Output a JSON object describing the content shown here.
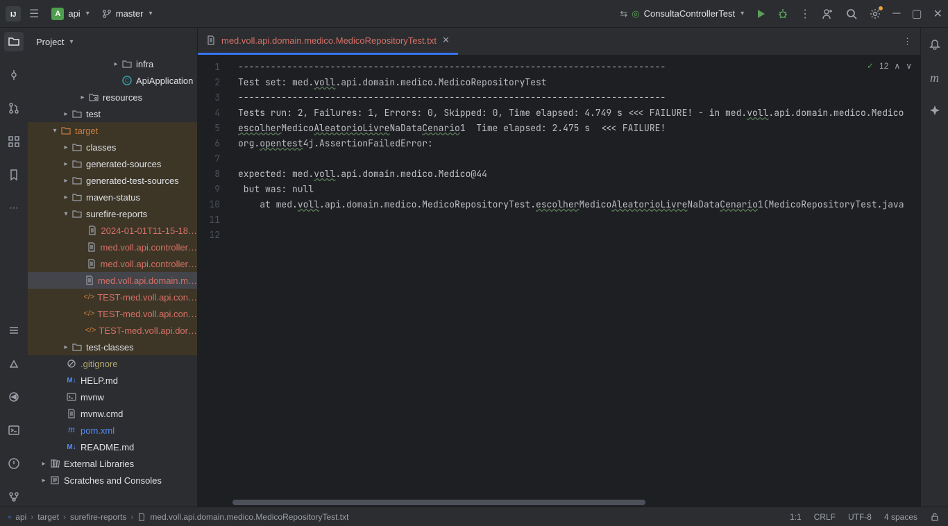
{
  "titlebar": {
    "project_name": "api",
    "branch": "master",
    "run_config": "ConsultaControllerTest"
  },
  "panel": {
    "title": "Project"
  },
  "tree": [
    {
      "indent": 120,
      "chev": ">",
      "icon": "folder",
      "label": "infra",
      "cls": ""
    },
    {
      "indent": 120,
      "chev": "",
      "icon": "circle-c",
      "label": "ApiApplication",
      "cls": ""
    },
    {
      "indent": 72,
      "chev": ">",
      "icon": "folder-res",
      "label": "resources",
      "cls": ""
    },
    {
      "indent": 48,
      "chev": ">",
      "icon": "folder",
      "label": "test",
      "cls": ""
    },
    {
      "indent": 32,
      "chev": "v",
      "icon": "folder-o",
      "label": "target",
      "cls": "label-orange",
      "hl": true
    },
    {
      "indent": 48,
      "chev": ">",
      "icon": "folder",
      "label": "classes",
      "cls": "",
      "hl": true
    },
    {
      "indent": 48,
      "chev": ">",
      "icon": "folder",
      "label": "generated-sources",
      "cls": "",
      "hl": true
    },
    {
      "indent": 48,
      "chev": ">",
      "icon": "folder",
      "label": "generated-test-sources",
      "cls": "",
      "hl": true
    },
    {
      "indent": 48,
      "chev": ">",
      "icon": "folder",
      "label": "maven-status",
      "cls": "",
      "hl": true
    },
    {
      "indent": 48,
      "chev": "v",
      "icon": "folder",
      "label": "surefire-reports",
      "cls": "",
      "hl": true
    },
    {
      "indent": 80,
      "chev": "",
      "icon": "txt",
      "label": "2024-01-01T11-15-18…",
      "cls": "label-red",
      "hl": true
    },
    {
      "indent": 80,
      "chev": "",
      "icon": "txt",
      "label": "med.voll.api.controller…",
      "cls": "label-red",
      "hl": true
    },
    {
      "indent": 80,
      "chev": "",
      "icon": "txt",
      "label": "med.voll.api.controller…",
      "cls": "label-red",
      "hl": true
    },
    {
      "indent": 80,
      "chev": "",
      "icon": "txt",
      "label": "med.voll.api.domain.m…",
      "cls": "label-red",
      "hl": true,
      "selected": true
    },
    {
      "indent": 80,
      "chev": "",
      "icon": "xml",
      "label": "TEST-med.voll.api.con…",
      "cls": "label-red",
      "hl": true
    },
    {
      "indent": 80,
      "chev": "",
      "icon": "xml",
      "label": "TEST-med.voll.api.con…",
      "cls": "label-red",
      "hl": true
    },
    {
      "indent": 80,
      "chev": "",
      "icon": "xml",
      "label": "TEST-med.voll.api.dor…",
      "cls": "label-red",
      "hl": true
    },
    {
      "indent": 48,
      "chev": ">",
      "icon": "folder",
      "label": "test-classes",
      "cls": "",
      "hl": true
    },
    {
      "indent": 40,
      "chev": "",
      "icon": "ignore",
      "label": ".gitignore",
      "cls": "label-yellow"
    },
    {
      "indent": 40,
      "chev": "",
      "icon": "md",
      "label": "HELP.md",
      "cls": ""
    },
    {
      "indent": 40,
      "chev": "",
      "icon": "sh",
      "label": "mvnw",
      "cls": ""
    },
    {
      "indent": 40,
      "chev": "",
      "icon": "txt",
      "label": "mvnw.cmd",
      "cls": ""
    },
    {
      "indent": 40,
      "chev": "",
      "icon": "maven",
      "label": "pom.xml",
      "cls": "label-blue"
    },
    {
      "indent": 40,
      "chev": "",
      "icon": "md",
      "label": "README.md",
      "cls": ""
    },
    {
      "indent": 16,
      "chev": ">",
      "icon": "lib",
      "label": "External Libraries",
      "cls": ""
    },
    {
      "indent": 16,
      "chev": ">",
      "icon": "scratch",
      "label": "Scratches and Consoles",
      "cls": ""
    }
  ],
  "tab": {
    "name": "med.voll.api.domain.medico.MedicoRepositoryTest.txt"
  },
  "inspection": {
    "count": "12"
  },
  "code_lines": [
    "-------------------------------------------------------------------------------",
    "Test set: med.voll.api.domain.medico.MedicoRepositoryTest",
    "-------------------------------------------------------------------------------",
    "Tests run: 2, Failures: 1, Errors: 0, Skipped: 0, Time elapsed: 4.749 s <<< FAILURE! - in med.voll.api.domain.medico.Medico",
    "escolherMedicoAleatorioLivreNaDataCenario1  Time elapsed: 2.475 s  <<< FAILURE!",
    "org.opentest4j.AssertionFailedError:",
    "",
    "expected: med.voll.api.domain.medico.Medico@44",
    " but was: null",
    "    at med.voll.api.domain.medico.MedicoRepositoryTest.escolherMedicoAleatorioLivreNaDataCenario1(MedicoRepositoryTest.java",
    "",
    ""
  ],
  "breadcrumb": [
    "api",
    "target",
    "surefire-reports",
    "med.voll.api.domain.medico.MedicoRepositoryTest.txt"
  ],
  "status": {
    "pos": "1:1",
    "sep": "CRLF",
    "enc": "UTF-8",
    "indent": "4 spaces"
  }
}
